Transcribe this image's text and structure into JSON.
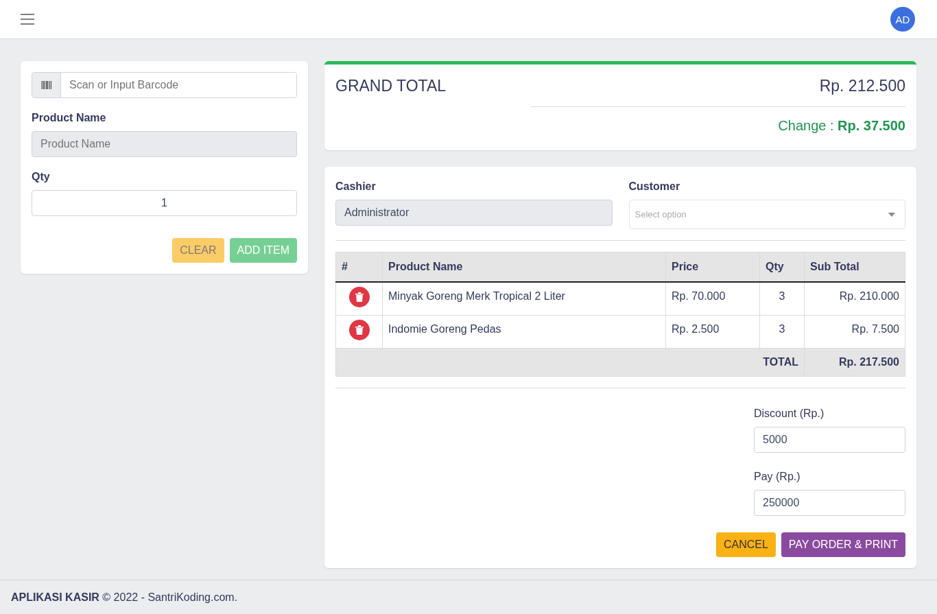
{
  "header": {
    "avatar": "AD"
  },
  "product_form": {
    "barcode": {
      "placeholder": "Scan or Input Barcode"
    },
    "product_name": {
      "label": "Product Name",
      "placeholder": "Product Name"
    },
    "qty": {
      "label": "Qty",
      "value": "1"
    },
    "buttons": [
      {
        "label": "CLEAR",
        "kind": "warning",
        "disabled": true
      },
      {
        "label": "ADD ITEM",
        "kind": "success",
        "disabled": true
      }
    ]
  },
  "grand_total": {
    "title": "GRAND TOTAL",
    "amount": "Rp. 212.500",
    "change": "Change : **Rp. 37.500**"
  },
  "order": {
    "cashier": {
      "label": "Cashier",
      "value": "Administrator"
    },
    "customer": {
      "label": "Customer",
      "placeholder": "Select option"
    },
    "table": {
      "columns": [
        "#",
        "Product Name",
        "Price",
        "Qty",
        "Sub Total"
      ],
      "rows": [
        {
          "product": "Minyak Goreng Merk Tropical 2 Liter",
          "price": "Rp. 70.000",
          "qty": "3",
          "subtotal": "Rp. 210.000"
        },
        {
          "product": "Indomie Goreng Pedas",
          "price": "Rp. 2.500",
          "qty": "3",
          "subtotal": "Rp. 7.500"
        }
      ],
      "total_label": "TOTAL",
      "total": "Rp. 217.500"
    },
    "discount": {
      "label": "Discount (Rp.)",
      "value": "5000"
    },
    "pay": {
      "label": "Pay (Rp.)",
      "value": "250000"
    },
    "buttons": [
      {
        "label": "CANCEL",
        "kind": "warning",
        "disabled": false
      },
      {
        "label": "PAY ORDER & PRINT",
        "kind": "purple",
        "disabled": false
      }
    ]
  },
  "footer": "**APLIKASI KASIR** © 2022 - SantriKoding.com."
}
